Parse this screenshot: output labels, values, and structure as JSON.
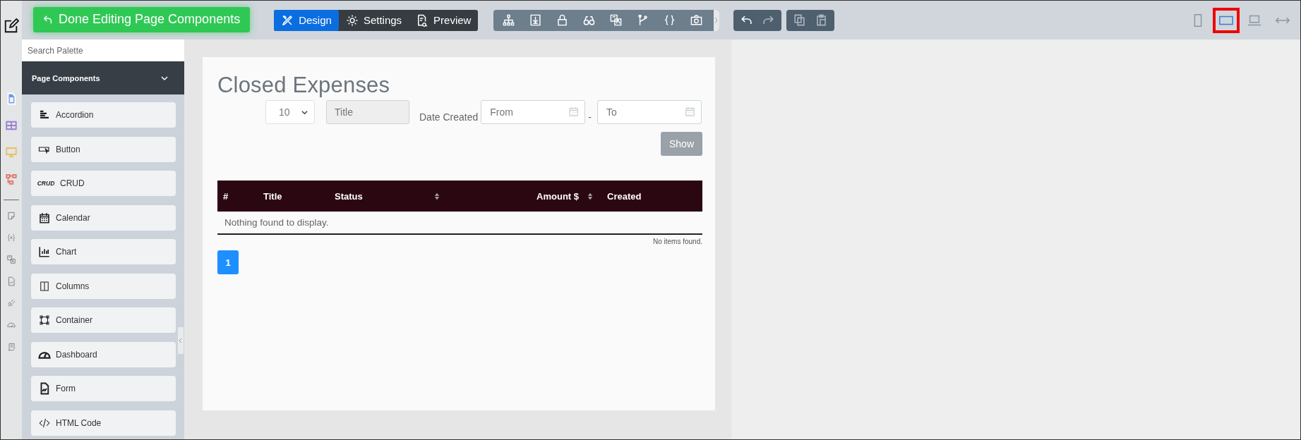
{
  "toolbar": {
    "done_button": "Done Editing Page Components",
    "modes": [
      {
        "label": "Design",
        "selected": true
      },
      {
        "label": "Settings",
        "selected": false
      },
      {
        "label": "Preview",
        "selected": false
      }
    ],
    "devices": [
      {
        "selected": false
      },
      {
        "selected": true
      },
      {
        "selected": false
      },
      {
        "selected": false
      }
    ]
  },
  "palette": {
    "search": {
      "placeholder": "Search Palette"
    },
    "section": {
      "title": "Page Components",
      "expanded": true
    },
    "items": [
      {
        "label": "Accordion"
      },
      {
        "label": "Button"
      },
      {
        "label": "CRUD",
        "badge": "CRUD"
      },
      {
        "label": "Calendar"
      },
      {
        "label": "Chart"
      },
      {
        "label": "Columns"
      },
      {
        "label": "Container"
      },
      {
        "label": "Dashboard"
      },
      {
        "label": "Form"
      },
      {
        "label": "HTML Code"
      }
    ]
  },
  "page": {
    "title": "Closed Expenses",
    "filters": {
      "page_size": "10",
      "title": {
        "placeholder": "Title"
      },
      "date_label": "Date Created",
      "from": {
        "placeholder": "From"
      },
      "separator": "-",
      "to": {
        "placeholder": "To"
      },
      "show_button": "Show"
    },
    "table": {
      "columns": [
        {
          "label": "#",
          "sortable": false
        },
        {
          "label": "Title",
          "sortable": false
        },
        {
          "label": "Status",
          "sortable": true
        },
        {
          "label": "Amount $",
          "sortable": true
        },
        {
          "label": "Created",
          "sortable": false
        }
      ],
      "empty_message": "Nothing found to display.",
      "footer": "No items found."
    },
    "pagination": [
      {
        "label": "1",
        "selected": true
      }
    ]
  }
}
